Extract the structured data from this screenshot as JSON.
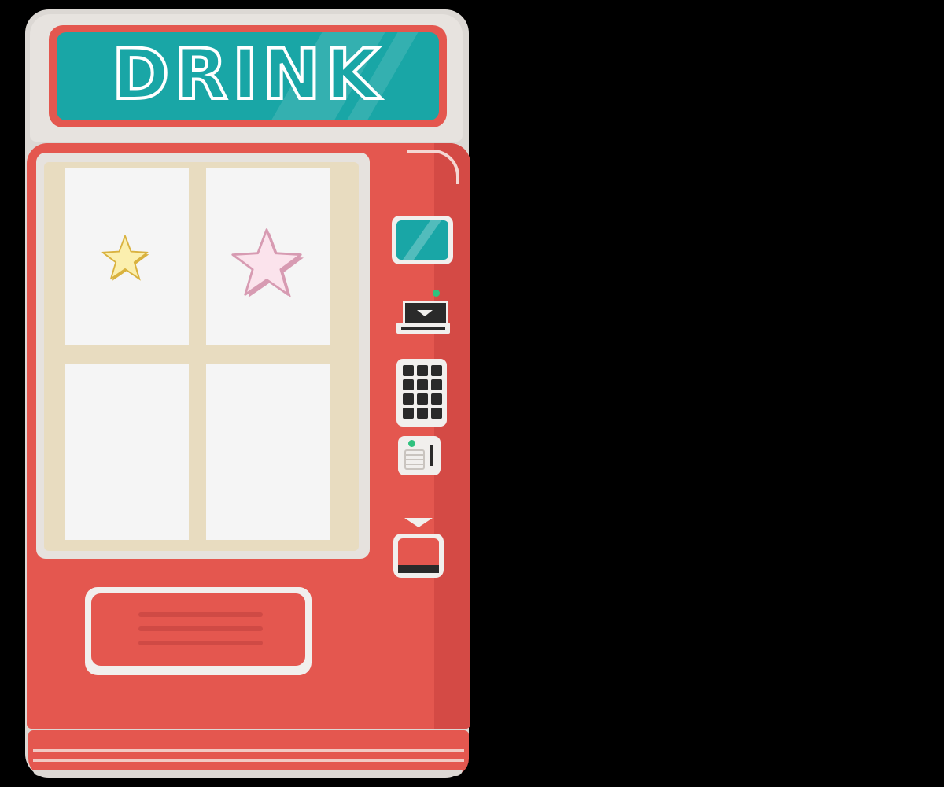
{
  "sign": {
    "text": "DRINK"
  },
  "colors": {
    "machine_red": "#e4574f",
    "sign_teal": "#19a6a6",
    "window_cream": "#e8dcc0",
    "indicator_green": "#2fc17e",
    "background": "#000000"
  },
  "slots": [
    {
      "item": "yellow-star"
    },
    {
      "item": "pink-star"
    },
    {
      "item": ""
    },
    {
      "item": ""
    }
  ],
  "controls": {
    "keypad_keys": 12,
    "icons": [
      "display-screen-icon",
      "card-slot-icon",
      "keypad-icon",
      "coin-slot-icon",
      "return-chute-icon"
    ]
  }
}
